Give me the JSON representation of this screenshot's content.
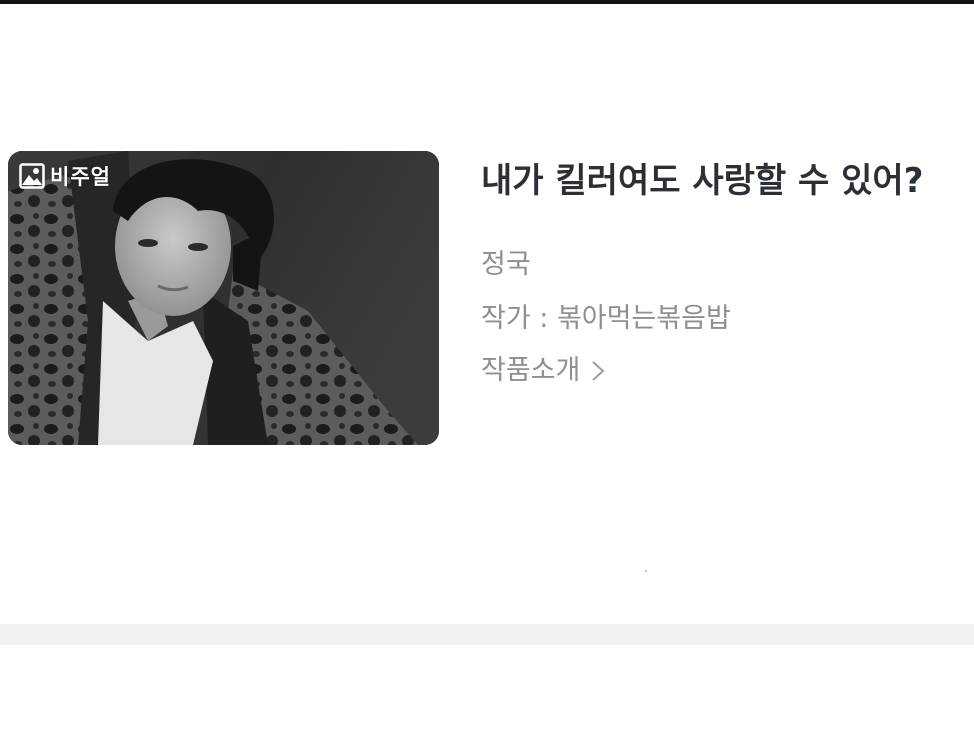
{
  "work": {
    "title": "내가 킬러여도 사랑할 수 있어?",
    "character": "정국",
    "author": "작가 : 볶아먹는볶음밥",
    "intro_label": "작품소개"
  },
  "thumbnail": {
    "badge_label": "비주얼",
    "badge_icon": "image-icon"
  },
  "icons": {
    "intro": "chevron-right-icon"
  }
}
